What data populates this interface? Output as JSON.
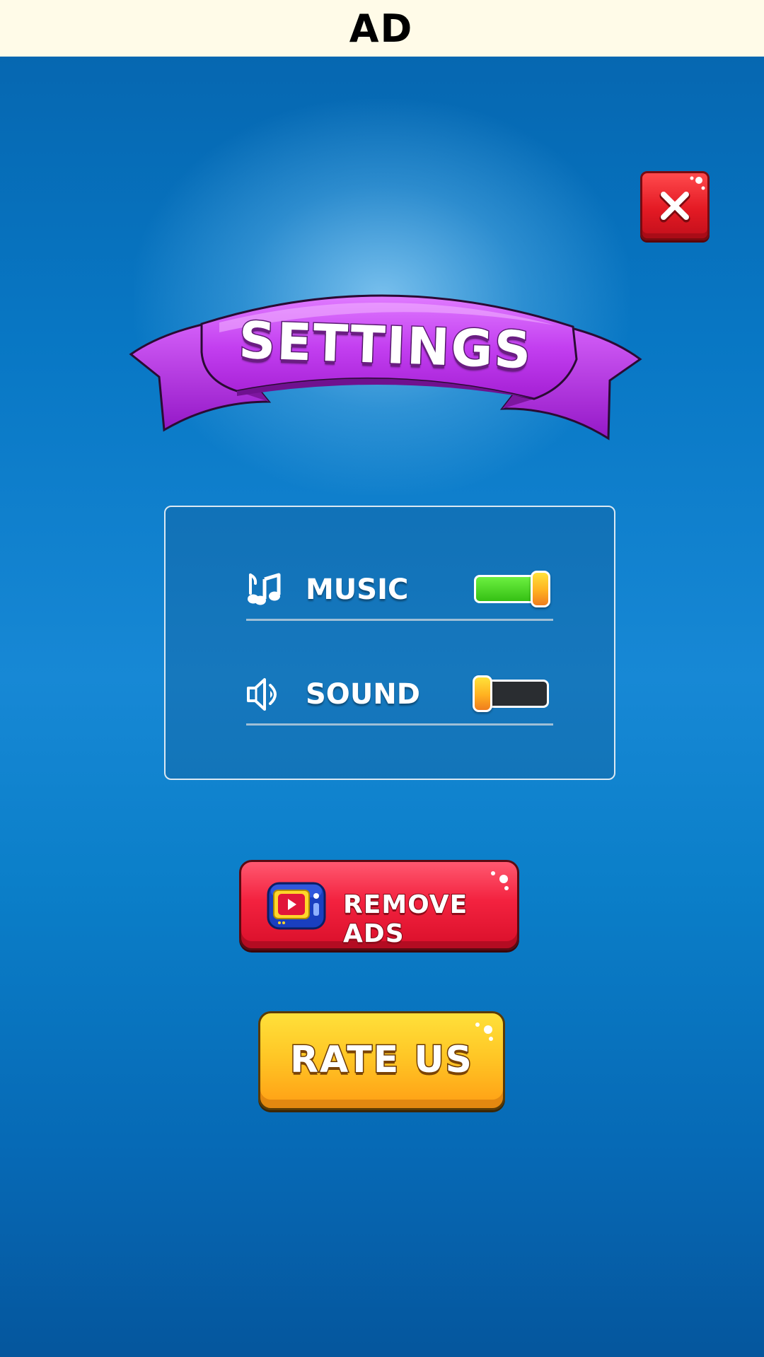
{
  "ad_bar": {
    "label": "AD"
  },
  "header": {
    "title": "SETTINGS"
  },
  "icons": {
    "close": "close-icon",
    "music": "music-note-icon",
    "sound": "speaker-icon",
    "remove_ads": "tv-play-icon"
  },
  "settings": {
    "music": {
      "label": "MUSIC",
      "enabled": true
    },
    "sound": {
      "label": "SOUND",
      "enabled": false
    }
  },
  "buttons": {
    "remove_ads": "REMOVE ADS",
    "rate_us": "RATE US"
  },
  "colors": {
    "background": "#0877c4",
    "banner": "#c33ff0",
    "close_button": "#e41a24",
    "remove_ads_button": "#f3223f",
    "rate_button": "#ffc726",
    "toggle_on": "#35c014",
    "toggle_off": "#2a2d31",
    "toggle_knob": "#ffb020"
  }
}
